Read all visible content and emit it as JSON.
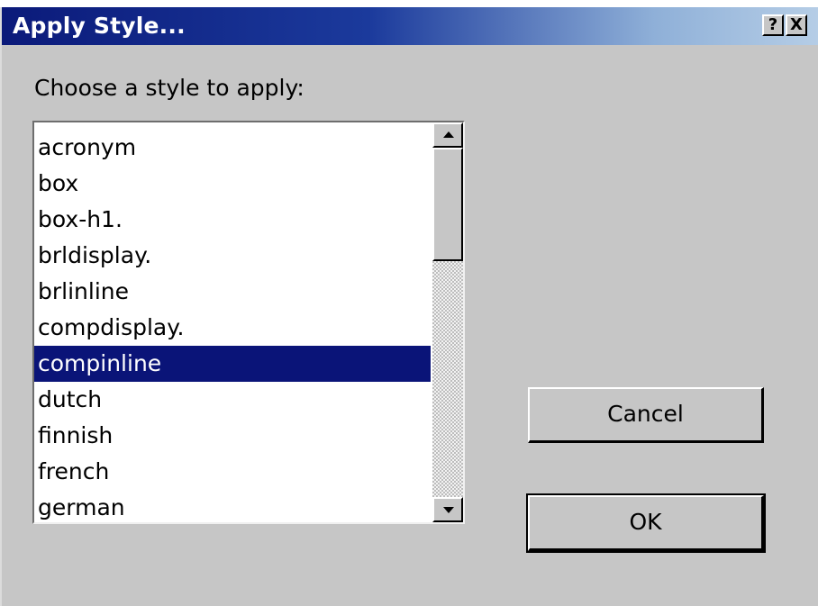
{
  "dialog": {
    "title": "Apply Style...",
    "help_glyph": "?",
    "close_glyph": "X"
  },
  "prompt": "Choose a style to apply:",
  "styles": {
    "items": [
      "acronym",
      "box",
      "box-h1.",
      "brldisplay.",
      "brlinline",
      "compdisplay.",
      "compinline",
      "dutch",
      "finnish",
      "french",
      "german"
    ],
    "selected": "compinline"
  },
  "buttons": {
    "cancel": "Cancel",
    "ok": "OK"
  },
  "colors": {
    "selection": "#0a1478",
    "dialog_face": "#c6c6c6"
  },
  "icons": {
    "help": "help-icon",
    "close": "close-icon",
    "scroll_up": "arrow-up-icon",
    "scroll_down": "arrow-down-icon"
  }
}
